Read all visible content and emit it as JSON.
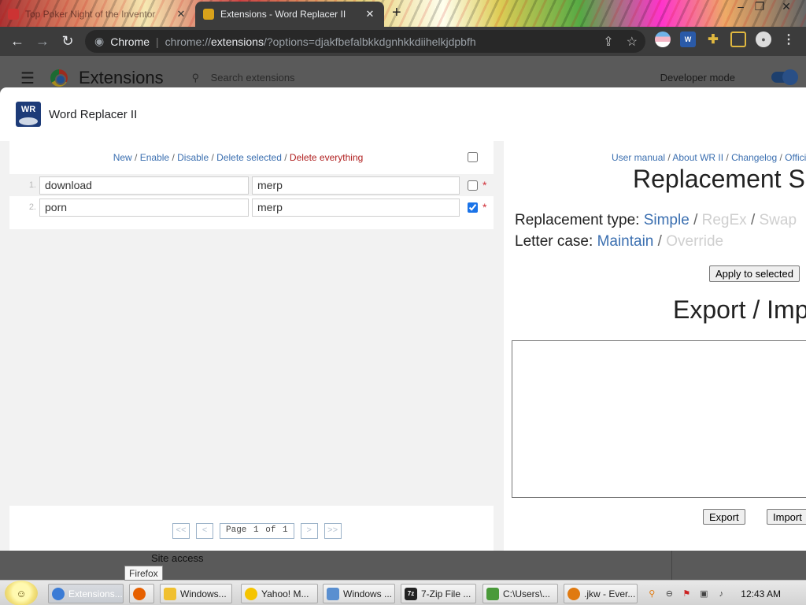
{
  "browser": {
    "tabs": [
      {
        "title": "Top Poker Night of the Inventor",
        "active": false
      },
      {
        "title": "Extensions - Word Replacer II",
        "active": true
      }
    ],
    "new_tab": "+",
    "window_controls": [
      "–",
      "❐",
      "✕"
    ],
    "omnibox": {
      "site_name": "Chrome",
      "separator": "|",
      "url_scheme": "chrome://",
      "url_host": "extensions",
      "url_rest": "/?options=djakfbefalbkkdgnhkkdiihelkjdpbfh"
    }
  },
  "extensions_page": {
    "title": "Extensions",
    "search_placeholder": "Search extensions",
    "developer_mode_label": "Developer mode",
    "developer_mode_on": true,
    "site_access_label": "Site access"
  },
  "dialog": {
    "title": "Word Replacer II",
    "logo_text": "WR",
    "actions": {
      "new": "New",
      "enable": "Enable",
      "disable": "Disable",
      "delete_selected": "Delete selected",
      "delete_everything": "Delete everything",
      "sep": " / "
    },
    "rules": [
      {
        "index": "1.",
        "find": "download",
        "replace": "merp",
        "checked": false,
        "marker": "*"
      },
      {
        "index": "2.",
        "find": "porn",
        "replace": "merp",
        "checked": true,
        "marker": "*"
      }
    ],
    "pager": {
      "first": "<<",
      "prev": "<",
      "page_word": "Page",
      "current": "1",
      "of_word": "of",
      "total": "1",
      "next": ">",
      "last": ">>"
    },
    "links": {
      "user_manual": "User manual",
      "about": "About WR II",
      "changelog": "Changelog",
      "official": "Offici",
      "sep": " / "
    },
    "settings_heading": "Replacement Se",
    "replacement_type_label": "Replacement type:",
    "replacement_types": {
      "simple": "Simple",
      "regex": "RegEx",
      "swap": "Swap"
    },
    "letter_case_label": "Letter case:",
    "letter_cases": {
      "maintain": "Maintain",
      "override": "Override"
    },
    "apply_button": "Apply to selected",
    "export_heading": "Export / Imp",
    "export_button": "Export",
    "import_button": "Import"
  },
  "tooltip": "Firefox",
  "taskbar": {
    "items": [
      {
        "label": "Extensions...",
        "icon": "chrome-icon",
        "color": "#3a7bd5"
      },
      {
        "label": "",
        "icon": "firefox-icon",
        "color": "#e66000"
      },
      {
        "label": "Windows...",
        "icon": "windows-live-icon",
        "color": "#f0c030"
      },
      {
        "label": "Yahoo! M...",
        "icon": "yahoo-messenger-icon",
        "color": "#f5c400"
      },
      {
        "label": "Windows ...",
        "icon": "window-icon",
        "color": "#5a8fd0"
      },
      {
        "label": "7-Zip File ...",
        "icon": "7zip-icon",
        "color": "#222222"
      },
      {
        "label": "C:\\Users\\...",
        "icon": "folder-home-icon",
        "color": "#4a9a3a"
      },
      {
        "label": ".jkw - Ever...",
        "icon": "everything-search-icon",
        "color": "#e07a10"
      }
    ],
    "clock": "12:43 AM"
  }
}
